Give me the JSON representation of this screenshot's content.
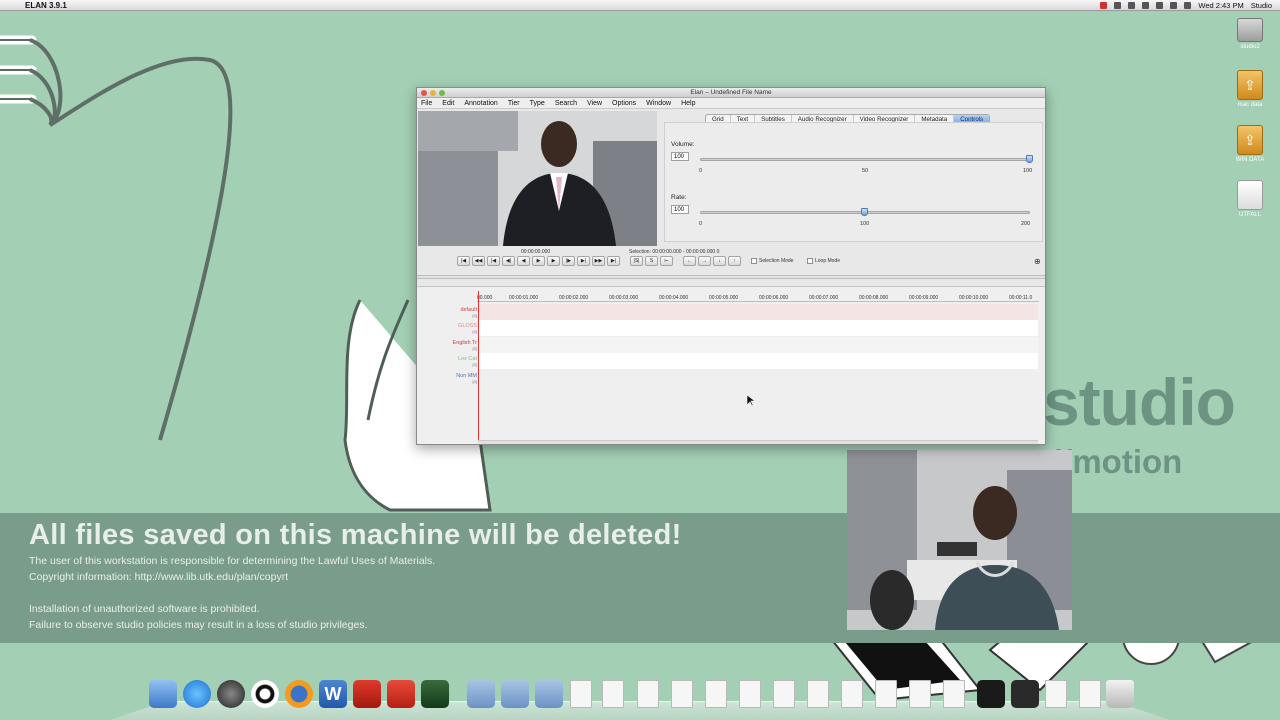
{
  "menubar": {
    "app_name": "ELAN 3.9.1",
    "clock": "Wed 2:43 PM",
    "user": "Studio"
  },
  "desktop_icons": [
    {
      "label": "studio2"
    },
    {
      "label": "mac data"
    },
    {
      "label": "WIN DATA"
    },
    {
      "label": "UTFALL"
    }
  ],
  "banner": {
    "headline": "All files saved on this machine will be deleted!",
    "line1": "The user of this workstation is responsible for determining the Lawful Uses of Materials.",
    "line2": "Copyright information:  http://www.lib.utk.edu/plan/copyrt",
    "line3": "Installation of unauthorized software is prohibited.",
    "line4": "Failure to observe studio policies may result in a loss of studio privileges."
  },
  "wallpaper": {
    "studio": "studio",
    "motion": "d/motion"
  },
  "elan": {
    "window_title": "Elan – Undefined File Name",
    "menu": [
      "File",
      "Edit",
      "Annotation",
      "Tier",
      "Type",
      "Search",
      "View",
      "Options",
      "Window",
      "Help"
    ],
    "tabs": [
      "Grid",
      "Text",
      "Subtitles",
      "Audio Recognizer",
      "Video Recognizer",
      "Metadata",
      "Controls"
    ],
    "active_tab": "Controls",
    "volume": {
      "label": "Volume:",
      "value": "100",
      "min": "0",
      "mid": "50",
      "max": "100",
      "level": 1.0
    },
    "rate": {
      "label": "Rate:",
      "value": "100",
      "min": "0",
      "mid": "100",
      "max": "200",
      "level": 0.5
    },
    "media_time": "00:00:00.000",
    "selection": "Selection: 00:00:00.000 - 00:00:00.000  0",
    "selection_mode": "Selection Mode",
    "loop_mode": "Loop Mode",
    "ruler_ticks": [
      "00.000",
      "00:00:01.000",
      "00:00:02.000",
      "00:00:03.000",
      "00:00:04.000",
      "00:00:05.000",
      "00:00:06.000",
      "00:00:07.000",
      "00:00:08.000",
      "00:00:09.000",
      "00:00:10.000",
      "00:00:11.0"
    ],
    "tiers": [
      {
        "name": "default",
        "count": "[0]",
        "color": "#d44040"
      },
      {
        "name": "GLOSS",
        "count": "[0]",
        "color": "#e08a8a"
      },
      {
        "name": "English Tr",
        "count": "[0]",
        "color": "#c04040"
      },
      {
        "name": "Lex Cat",
        "count": "[0]",
        "color": "#7fc27a"
      },
      {
        "name": "Non MM",
        "count": "[0]",
        "color": "#5b6fb0"
      }
    ]
  },
  "dock_items": [
    "Finder",
    "App Store",
    "DVD Player",
    "Camera",
    "Firefox",
    "Word",
    "Acrobat",
    "Crossover",
    "Photo",
    "Documents",
    "Downloads",
    "Trash"
  ]
}
